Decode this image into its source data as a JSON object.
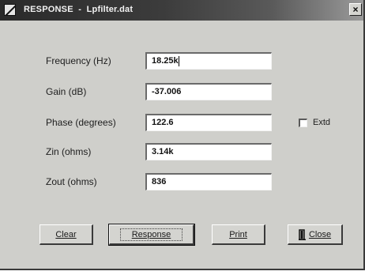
{
  "window": {
    "title": "RESPONSE  -  Lpfilter.dat",
    "close_glyph": "×"
  },
  "fields": [
    {
      "label": "Frequency (Hz)",
      "value": "18.25k"
    },
    {
      "label": "Gain (dB)",
      "value": "-37.006"
    },
    {
      "label": "Phase (degrees)",
      "value": "122.6"
    },
    {
      "label": "Zin (ohms)",
      "value": "3.14k"
    },
    {
      "label": "Zout (ohms)",
      "value": "836"
    }
  ],
  "extd": {
    "label": "Extd",
    "checked": false
  },
  "buttons": {
    "clear": "Clear",
    "response": "Response",
    "print": "Print",
    "close": "Close"
  }
}
